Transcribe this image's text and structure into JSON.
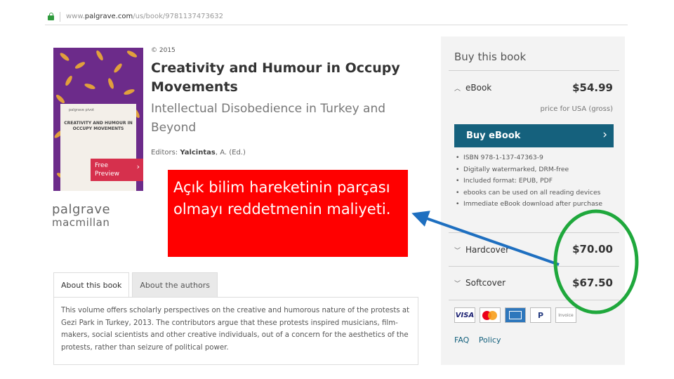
{
  "browser": {
    "url_prefix": "www.",
    "url_host": "palgrave.com",
    "url_path": "/us/book/9781137473632"
  },
  "book": {
    "copyright": "© 2015",
    "title": "Creativity and Humour in Occupy Movements",
    "subtitle": "Intellectual Disobedience in Turkey and Beyond",
    "editors_label": "Editors:",
    "editors_name": "Yalcintas",
    "editors_suffix": ", A. (Ed.)",
    "cover_series": "palgrave pivot",
    "cover_title": "CREATIVITY AND HUMOUR IN OCCUPY MOVEMENTS",
    "preview_line1": "Free",
    "preview_line2": "Preview"
  },
  "publisher": {
    "line1": "palgrave",
    "line2": "macmillan"
  },
  "overlay_text": "Açık bilim hareketinin parçası olmayı reddetmenin maliyeti.",
  "tabs": [
    {
      "label": "About this book"
    },
    {
      "label": "About the authors"
    }
  ],
  "about_text": "This volume offers scholarly perspectives on the creative and humorous nature of the protests at Gezi Park in Turkey, 2013. The contributors argue that these protests inspired musicians, film-makers, social scientists and other creative individuals, out of a concern for the aesthetics of the protests, rather than seizure of political power.",
  "purchase": {
    "heading": "Buy this book",
    "ebook": {
      "label": "eBook",
      "price": "$54.99",
      "note": "price for USA (gross)",
      "button": "Buy eBook"
    },
    "features": [
      "ISBN 978-1-137-47363-9",
      "Digitally watermarked, DRM-free",
      "Included format: EPUB, PDF",
      "ebooks can be used on all reading devices",
      "Immediate eBook download after purchase"
    ],
    "hardcover": {
      "label": "Hardcover",
      "price": "$70.00"
    },
    "softcover": {
      "label": "Softcover",
      "price": "$67.50"
    },
    "cards": {
      "visa": "VISA",
      "paypal": "P",
      "invoice": "Invoice"
    },
    "links": {
      "faq": "FAQ",
      "policy": "Policy"
    }
  },
  "colors": {
    "accent": "#15617d",
    "overlay": "#ff0000",
    "arrow": "#1e6fc0",
    "circle": "#1fa83c",
    "cover": "#6c2b8a",
    "preview": "#d6304d"
  }
}
